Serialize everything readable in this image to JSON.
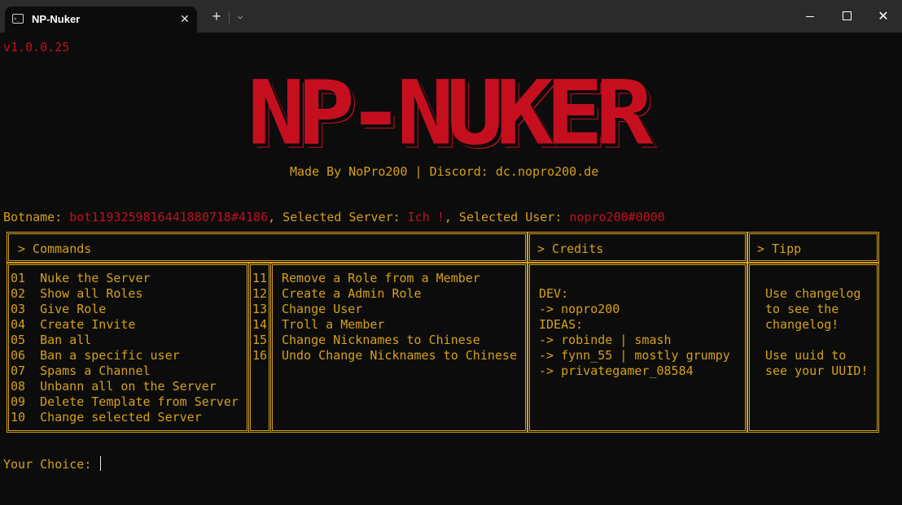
{
  "window": {
    "tab_title": "NP-Nuker",
    "tab_icon": "terminal-icon",
    "tab_close": "✕",
    "new_tab": "+",
    "dropdown": "⌄",
    "minimize": "minimize-icon",
    "maximize": "maximize-icon",
    "close": "✕"
  },
  "terminal": {
    "version": "v1.0.0.25",
    "logo": "NP-NUKER",
    "made_by": "Made By NoPro200 | Discord: dc.nopro200.de",
    "botname_label": "Botname: ",
    "botname_value": "bot1193259816441880718#4186",
    "server_label": ", Selected Server: ",
    "server_value": "Ich !",
    "user_label": ", Selected User: ",
    "user_value": "nopro200#0000",
    "headers": {
      "commands": "> Commands",
      "credits": "> Credits",
      "tipp": "> Tipp"
    },
    "commands_left": [
      {
        "num": "01",
        "label": "Nuke the Server"
      },
      {
        "num": "02",
        "label": "Show all Roles"
      },
      {
        "num": "03",
        "label": "Give Role"
      },
      {
        "num": "04",
        "label": "Create Invite"
      },
      {
        "num": "05",
        "label": "Ban all"
      },
      {
        "num": "06",
        "label": "Ban a specific user"
      },
      {
        "num": "07",
        "label": "Spams a Channel"
      },
      {
        "num": "08",
        "label": "Unbann all on the Server"
      },
      {
        "num": "09",
        "label": "Delete Template from Server"
      },
      {
        "num": "10",
        "label": "Change selected Server"
      }
    ],
    "commands_right": [
      {
        "num": "11",
        "label": "Remove a Role from a Member"
      },
      {
        "num": "12",
        "label": "Create a Admin Role"
      },
      {
        "num": "13",
        "label": "Change User"
      },
      {
        "num": "14",
        "label": "Troll a Member"
      },
      {
        "num": "15",
        "label": "Change Nicknames to Chinese"
      },
      {
        "num": "16",
        "label": "Undo Change Nicknames to Chinese"
      }
    ],
    "credits": [
      "",
      "DEV:",
      "-> nopro200",
      "IDEAS:",
      "-> robinde | smash",
      "-> fynn_55 | mostly grumpy",
      "-> privategamer_08584"
    ],
    "tipp": [
      "",
      "Use changelog",
      "to see the",
      "changelog!",
      "",
      "Use uuid to",
      "see your UUID!"
    ],
    "prompt": "Your Choice: "
  },
  "colors": {
    "background": "#0c0c0c",
    "titlebar": "#2b2b2b",
    "accent_red": "#c50f1f",
    "accent_yellow": "#d4a11a"
  }
}
